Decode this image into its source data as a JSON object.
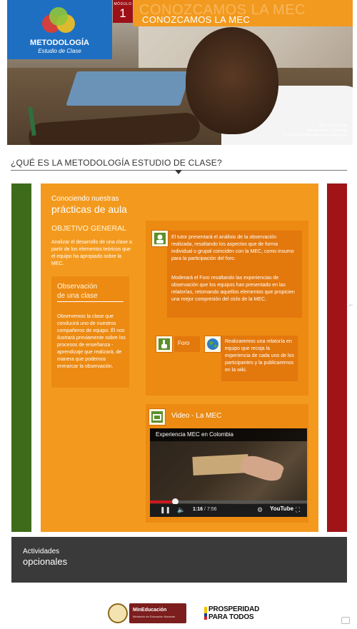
{
  "header": {
    "logo_title": "METODOLOGÍA",
    "logo_subtitle": "Estudio de Clase",
    "module_label": "MÓDULO",
    "module_number": "1",
    "title_ghost": "CONOZCAMOS LA MEC",
    "title": "CONOZCAMOS LA MEC",
    "photo_caption": [
      "Niño de escuela",
      "Florida Valle, Colombia",
      "© UNESCO/Ministerio de Educación"
    ]
  },
  "section": {
    "question": "¿QUÉ ES LA METODOLOGÍA ESTUDIO DE CLASE?"
  },
  "main": {
    "kicker": "Conociendo nuestras",
    "headline": "prácticas de aula",
    "objective_title": "OBJETIVO GENERAL",
    "objective_text": "Analizar el desarrollo de una clase a partir de los elementos teóricos que el equipo ha apropiado sobre la MEC.",
    "observation_title_1": "Observación",
    "observation_title_2": "de una clase",
    "observation_text": "Observemos la clase que conducirá uno de nuestros compañeros de equipo. Él nos ilustrará previamente sobre los procesos de enseñanza - aprendizaje que realizará, de manera que podemos enmarcar la observación.",
    "tutor_text_1": "El tutor presentará el análisis de la observación realizada, resaltando los aspectos que de forma individual o grupal coinciden con la MEC, como insumo para la participación del foro.",
    "tutor_text_2": "Moderará el Foro resaltando las experiencias de observación que los equipos han presentado en las relatorías, retomando aquellos elementos que propicien una mejor compresión del ciclo de la MEC.",
    "foro_label": "Foro",
    "relatoria_text": "Realizaremos una relatoría en equipo que recoja la experiencia de cada uno de los participantes y la publicaremos en la wiki.",
    "video_section_title": "Video - La MEC"
  },
  "video": {
    "title": "Experiencia MEC en Colombia",
    "current_time": "1:16",
    "total_time": "7:56",
    "progress": 0.161,
    "youtube_label": "YouTube"
  },
  "optional": {
    "kicker": "Actividades",
    "title": "opcionales"
  },
  "footer": {
    "ministry_name": "MinEducación",
    "ministry_sub": "Ministerio de Educación Nacional",
    "prosperity_line1": "PROSPERIDAD",
    "prosperity_line2": "PARA TODOS"
  },
  "colors": {
    "orange": "#f39a1e",
    "green": "#3e6b1a",
    "red": "#a01418",
    "blue": "#1e6fc2"
  }
}
